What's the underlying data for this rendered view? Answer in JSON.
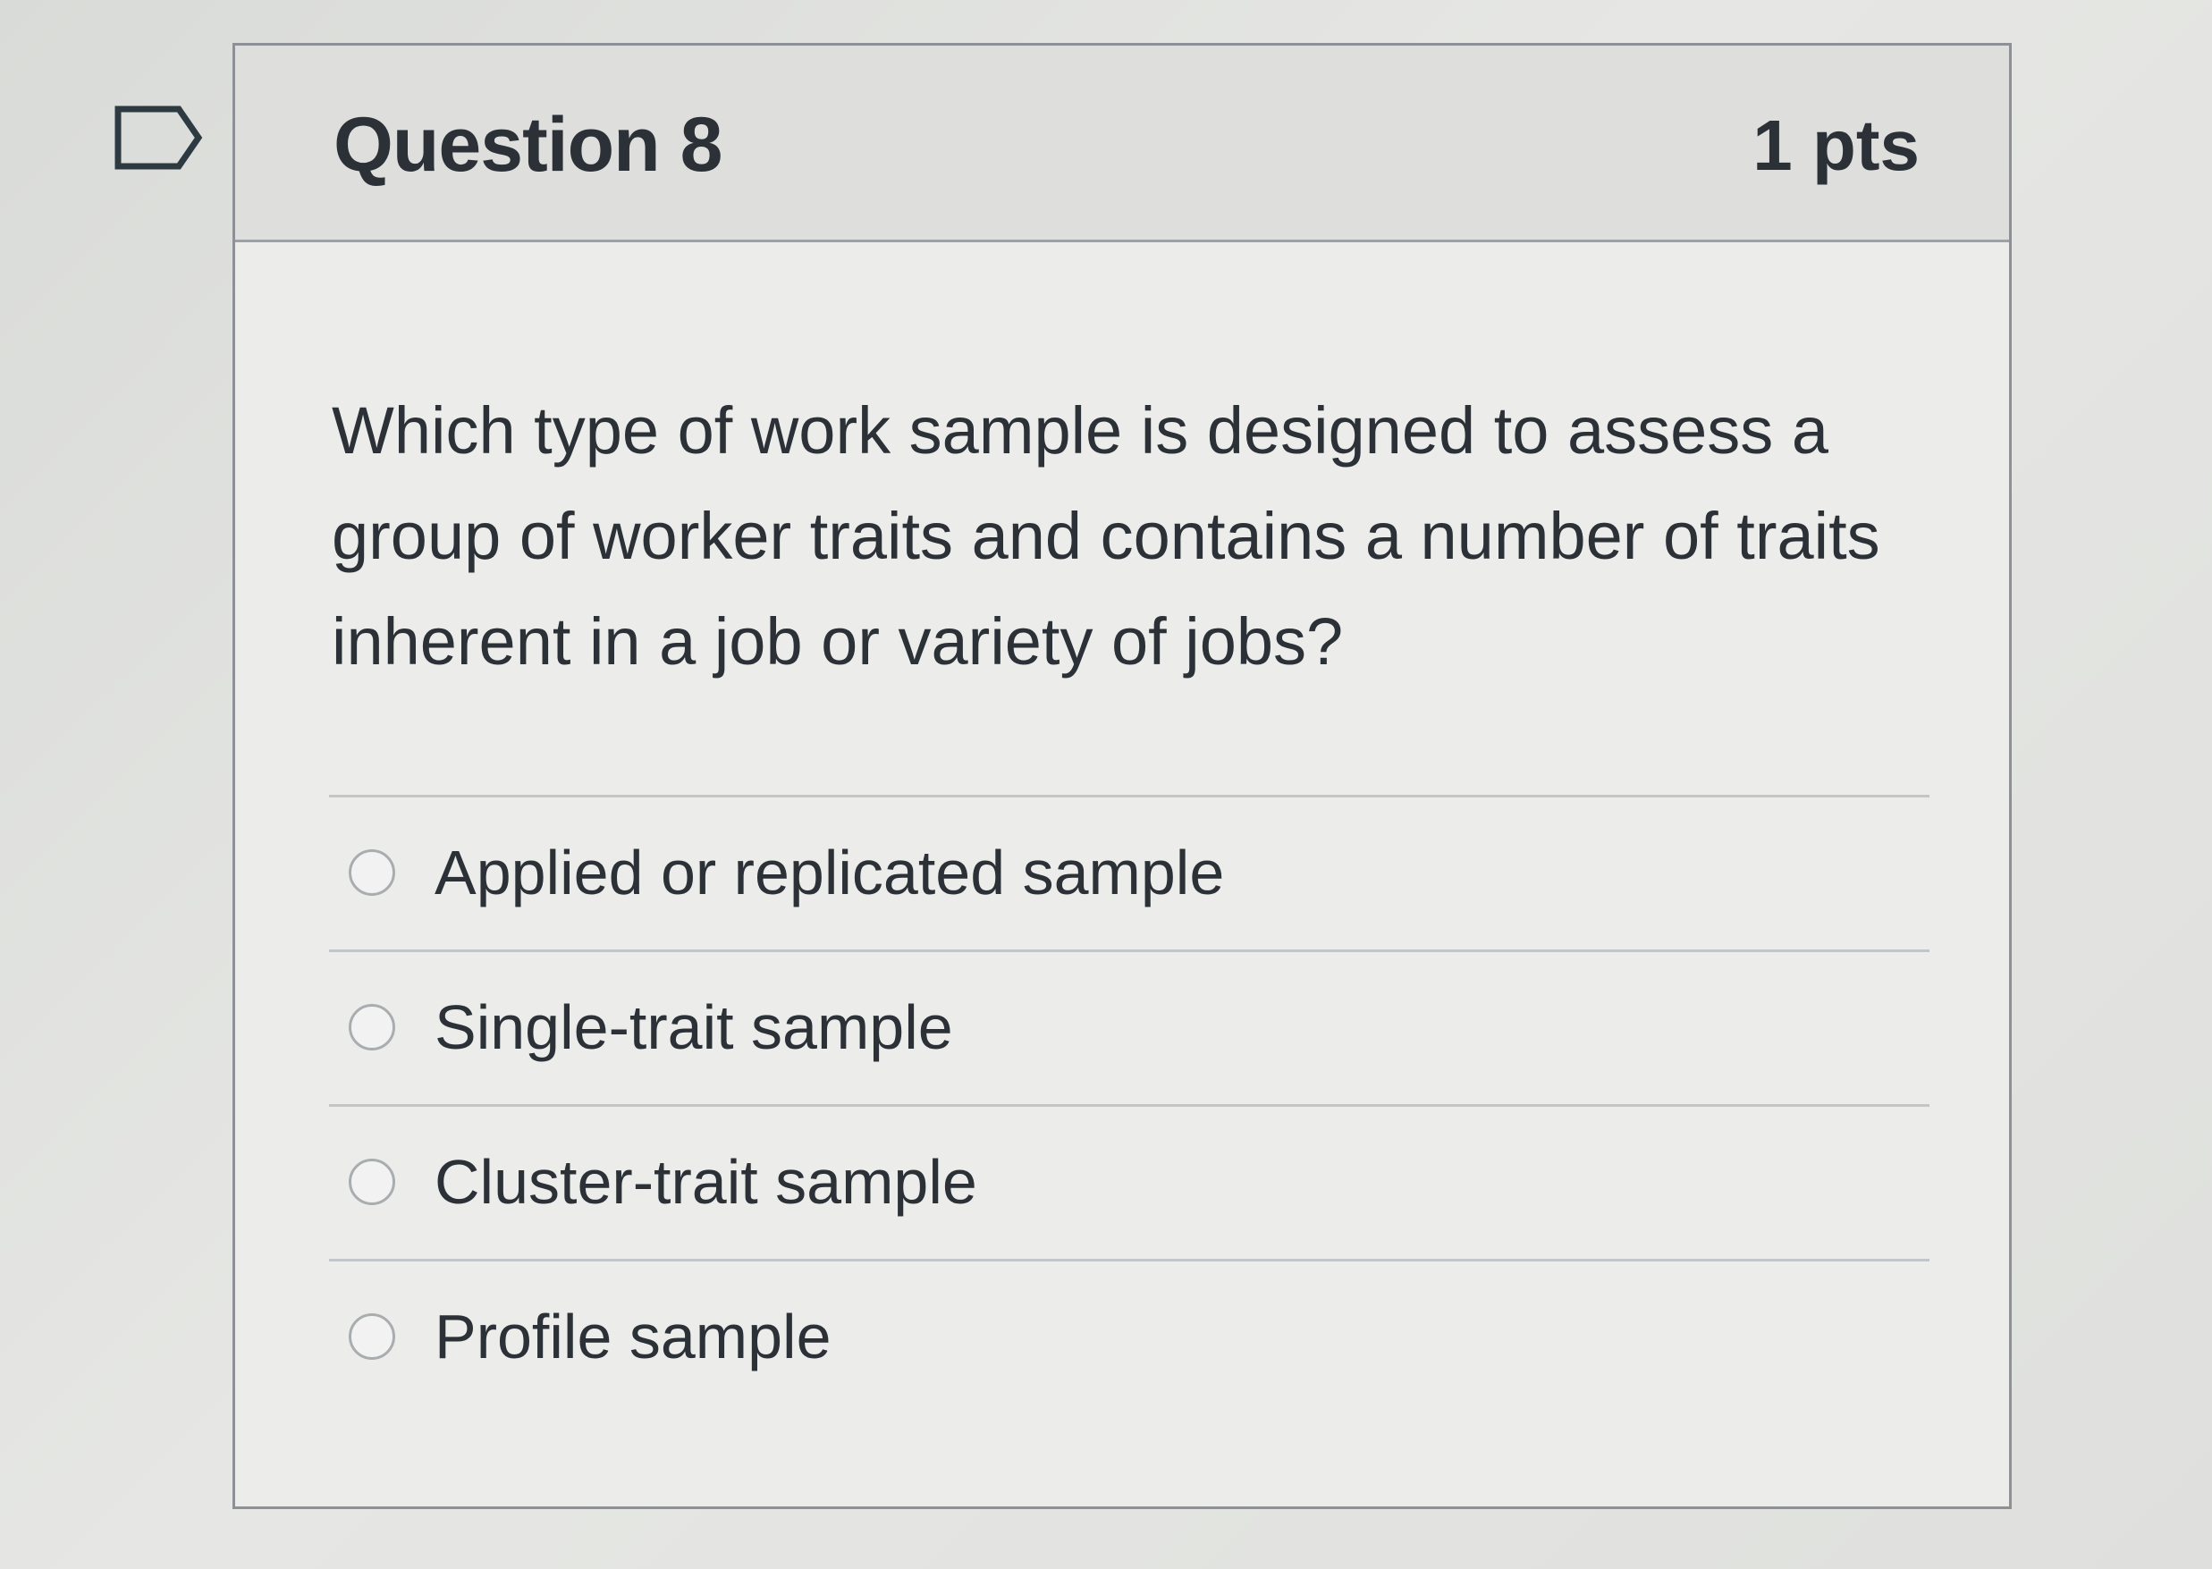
{
  "quiz": {
    "question_title": "Question 8",
    "points": "1 pts",
    "question_text": "Which type of work sample is designed to assess a group of worker traits and contains a number of traits inherent in a job or variety of jobs?",
    "answers": [
      {
        "label": "Applied or replicated sample"
      },
      {
        "label": "Single-trait sample"
      },
      {
        "label": "Cluster-trait sample"
      },
      {
        "label": "Profile sample"
      }
    ]
  },
  "icons": {
    "flag": "flag-question-icon",
    "radio": "radio-button-icon"
  },
  "colors": {
    "text": "#2b3136",
    "header_background": "#dedfdd",
    "border": "#8d9195"
  }
}
